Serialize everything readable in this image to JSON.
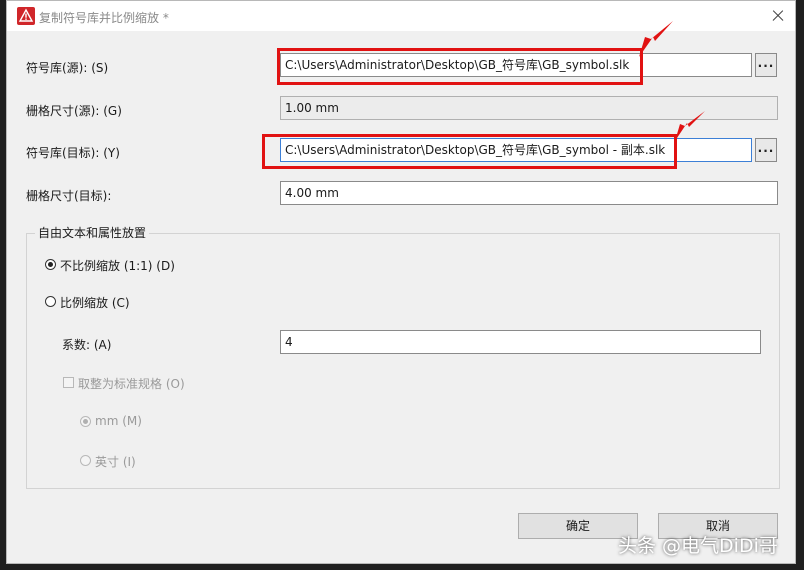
{
  "window": {
    "title": "复制符号库并比例缩放 *",
    "app_icon": "warning-triangle-icon",
    "close_icon": "close-icon"
  },
  "fields": {
    "source_library_label": "符号库(源): (S)",
    "source_library_value": "C:\\Users\\Administrator\\Desktop\\GB_符号库\\GB_symbol.slk",
    "source_grid_label": "栅格尺寸(源): (G)",
    "source_grid_value": "1.00 mm",
    "target_library_label": "符号库(目标): (Y)",
    "target_library_value": "C:\\Users\\Administrator\\Desktop\\GB_符号库\\GB_symbol - 副本.slk",
    "target_grid_label": "栅格尺寸(目标):",
    "target_grid_value": "4.00 mm",
    "browse_label": "..."
  },
  "group": {
    "title": "自由文本和属性放置",
    "option_no_scale": "不比例缩放 (1:1) (D)",
    "option_scale": "比例缩放 (C)",
    "factor_label": "系数: (A)",
    "factor_value": "4",
    "round_label": "取整为标准规格 (O)",
    "unit_mm": "mm (M)",
    "unit_inch": "英寸 (I)"
  },
  "buttons": {
    "ok": "确定",
    "cancel": "取消"
  },
  "watermark": "头条 @电气DiDi哥",
  "colors": {
    "highlight": "#e11212",
    "focus_border": "#3c7fd6",
    "dialog_bg": "#f0f0f0"
  }
}
